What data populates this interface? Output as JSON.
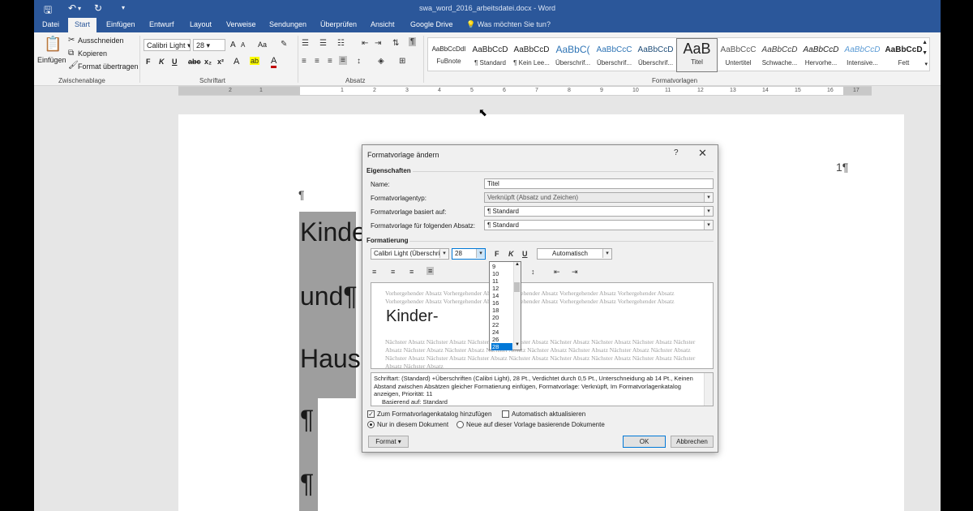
{
  "window": {
    "title": "swa_word_2016_arbeitsdatei.docx - Word",
    "quick_access": [
      "save-icon",
      "undo-icon",
      "redo-icon",
      "customize-icon"
    ]
  },
  "tabs": [
    "Datei",
    "Start",
    "Einfügen",
    "Entwurf",
    "Layout",
    "Verweise",
    "Sendungen",
    "Überprüfen",
    "Ansicht",
    "Google Drive"
  ],
  "active_tab": "Start",
  "tell_me": "Was möchten Sie tun?",
  "ribbon": {
    "clipboard": {
      "paste": "Einfügen",
      "cut": "Ausschneiden",
      "copy": "Kopieren",
      "format_painter": "Format übertragen",
      "group": "Zwischenablage"
    },
    "font": {
      "name": "Calibri Light",
      "size": "28",
      "bold": "F",
      "italic": "K",
      "underline": "U",
      "strike": "abc",
      "subscript": "x₂",
      "superscript": "x²",
      "grow": "A",
      "shrink": "A",
      "case": "Aa",
      "effects": "A",
      "highlight": "ab",
      "color": "A",
      "group": "Schriftart"
    },
    "paragraph": {
      "group": "Absatz"
    },
    "styles": {
      "group": "Formatvorlagen",
      "items": [
        {
          "preview": "AaBbCcDdI",
          "name": "FuBnote"
        },
        {
          "preview": "AaBbCcD",
          "name": "¶ Standard"
        },
        {
          "preview": "AaBbCcD",
          "name": "¶ Kein Lee..."
        },
        {
          "preview": "AaBbC(",
          "name": "Überschrif..."
        },
        {
          "preview": "AaBbCcC",
          "name": "Überschrif..."
        },
        {
          "preview": "AaBbCcD",
          "name": "Überschrif..."
        },
        {
          "preview": "AaB",
          "name": "Titel"
        },
        {
          "preview": "AaBbCcC",
          "name": "Untertitel"
        },
        {
          "preview": "AaBbCcD",
          "name": "Schwache..."
        },
        {
          "preview": "AaBbCcD",
          "name": "Hervorhe..."
        },
        {
          "preview": "AaBbCcD",
          "name": "Intensive..."
        },
        {
          "preview": "AaBbCcD",
          "name": "Fett"
        }
      ],
      "selected": "Titel"
    }
  },
  "ruler": [
    "1",
    "2",
    "1",
    "2",
    "3",
    "4",
    "5",
    "6",
    "7",
    "8",
    "9",
    "10",
    "11",
    "12",
    "13",
    "14",
    "15",
    "16",
    "17"
  ],
  "document": {
    "page_number": "1¶",
    "pilcrow": "¶",
    "lines": [
      "Kinde",
      "und¶",
      "Haus"
    ],
    "lower_pilcrows": [
      "¶",
      "¶"
    ]
  },
  "dialog": {
    "title": "Formatvorlage ändern",
    "help": "?",
    "close": "✕",
    "section_properties": "Eigenschaften",
    "name_label": "Name:",
    "name_value": "Titel",
    "type_label": "Formatvorlagentyp:",
    "type_value": "Verknüpft (Absatz und Zeichen)",
    "based_label": "Formatvorlage basiert auf:",
    "based_value": "¶  Standard",
    "next_label": "Formatvorlage für folgenden Absatz:",
    "next_value": "¶  Standard",
    "section_format": "Formatierung",
    "font_value": "Calibri Light (Überschrift",
    "size_value": "28",
    "bold": "F",
    "italic": "K",
    "underline": "U",
    "color_value": "Automatisch",
    "size_options": [
      "9",
      "10",
      "11",
      "12",
      "14",
      "16",
      "18",
      "20",
      "22",
      "24",
      "26",
      "28"
    ],
    "size_selected": "28",
    "preview_before": "Vorhergehender Absatz Vorhergehender Absatz Vorhergehender Absatz Vorhergehender Absatz Vorhergehender Absatz Vorhergehender Absatz Vorhergehender Absatz Vorhergehender Absatz Vorhergehender Absatz Vorhergehender Absatz",
    "preview_text": "Kinder-",
    "preview_after": "Nächster Absatz Nächster Absatz Nächster Absatz Nächster Absatz Nächster Absatz Nächster Absatz Nächster Absatz Nächster Absatz Nächster Absatz Nächster Absatz Nächster Absatz Nächster Absatz Nächster Absatz Nächster Absatz Nächster Absatz Nächster Absatz Nächster Absatz Nächster Absatz Nächster Absatz Nächster Absatz Nächster Absatz Nächster Absatz Nächster Absatz Nächster Absatz",
    "description": "Schriftart: (Standard) +Überschriften (Calibri Light), 28 Pt., Verdichtet durch  0,5 Pt., Unterschneidung ab 14 Pt., Keinen Abstand zwischen Absätzen gleicher Formatierung einfügen, Formatvorlage: Verknüpft, Im Formatvorlagenkatalog anzeigen, Priorität: 11",
    "description_2": "Basierend auf: Standard",
    "add_gallery": "Zum Formatvorlagenkatalog hinzufügen",
    "auto_update": "Automatisch aktualisieren",
    "only_doc": "Nur in diesem Dokument",
    "new_docs": "Neue auf dieser Vorlage basierende Dokumente",
    "format_btn": "Format ▾",
    "ok": "OK",
    "cancel": "Abbrechen"
  },
  "colors": {
    "accent": "#2b579a",
    "highlight": "#0078d7"
  }
}
